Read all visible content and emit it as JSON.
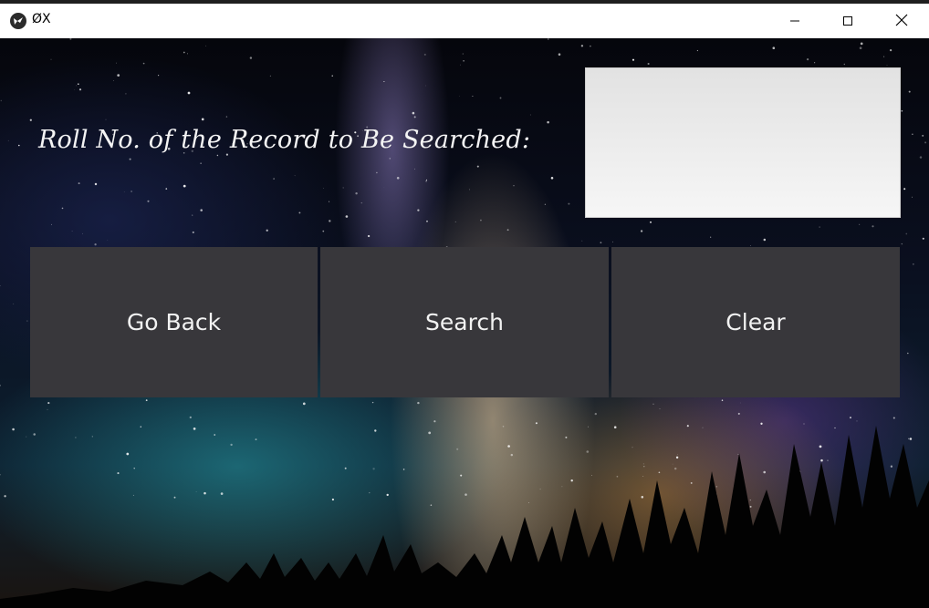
{
  "window": {
    "title": "ØX",
    "controls": {
      "minimize_icon": "minimize-icon",
      "maximize_icon": "maximize-icon",
      "close_icon": "close-icon"
    }
  },
  "form": {
    "label": "Roll No. of the Record to Be Searched:",
    "input_value": "",
    "input_placeholder": ""
  },
  "buttons": {
    "go_back": "Go Back",
    "search": "Search",
    "clear": "Clear"
  },
  "colors": {
    "button_bg": "#38373b",
    "button_text": "#f2f2f2",
    "input_bg": "#ececec",
    "label_text": "#f4f4f4"
  }
}
